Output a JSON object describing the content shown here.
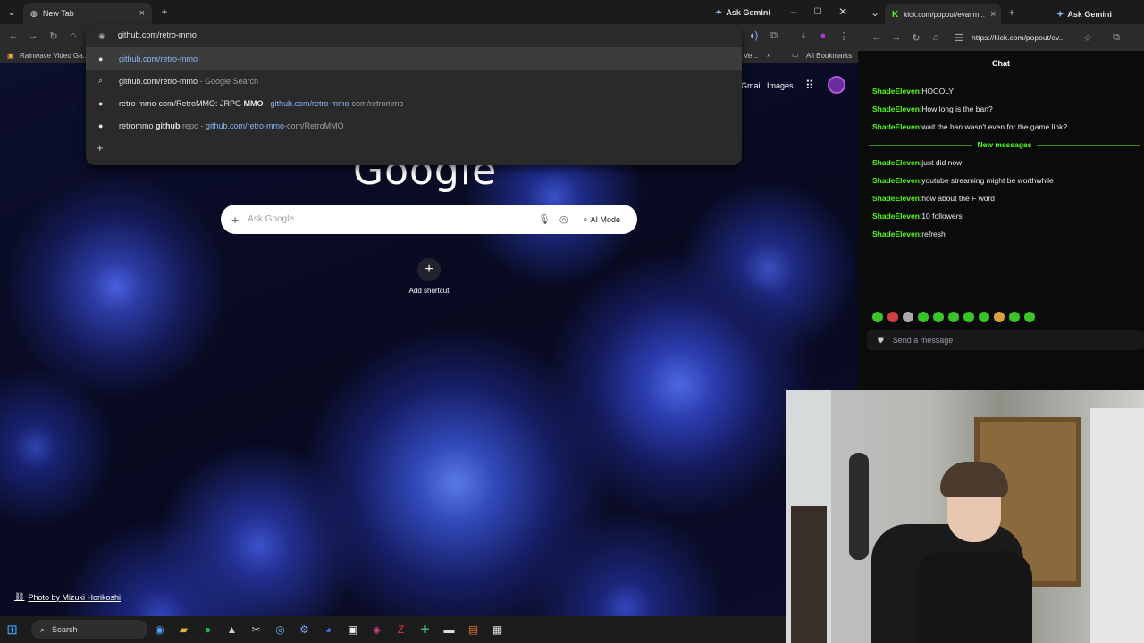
{
  "left_browser": {
    "tab_title": "New Tab",
    "gemini": "Ask Gemini",
    "omnibox": {
      "typed": "github.com/retro-mmo",
      "suggestions": [
        {
          "icon": "github-icon",
          "parts": [
            {
              "t": "github.com/retro-mmo",
              "c": "url"
            }
          ]
        },
        {
          "icon": "search-icon",
          "parts": [
            {
              "t": "github.com/retro-mmo",
              "c": ""
            },
            {
              "t": " - Google Search",
              "c": "dim"
            }
          ]
        },
        {
          "icon": "github-icon",
          "parts": [
            {
              "t": "retro-mmo-com/Retro",
              "c": ""
            },
            {
              "t": "MMO: JRPG ",
              "c": ""
            },
            {
              "t": "MMO",
              "c": "b"
            },
            {
              "t": "  -  ",
              "c": "dim"
            },
            {
              "t": "github.com/retro-mmo",
              "c": "url"
            },
            {
              "t": "-com/retrommo",
              "c": "dim"
            }
          ]
        },
        {
          "icon": "github-icon",
          "parts": [
            {
              "t": "retrommo ",
              "c": ""
            },
            {
              "t": "github",
              "c": "b"
            },
            {
              "t": " repo  -  ",
              "c": "dim"
            },
            {
              "t": "github.com/retro-mmo",
              "c": "url"
            },
            {
              "t": "-com/RetroMMO",
              "c": "dim"
            }
          ]
        }
      ]
    },
    "bookmarks": {
      "first": "Rainwave Video Ga...",
      "partial": "Ve...",
      "all": "All Bookmarks"
    },
    "newtab": {
      "gmail": "Gmail",
      "images": "Images",
      "logo": "Google",
      "search_placeholder": "Ask Google",
      "ai_mode": "AI Mode",
      "add_shortcut": "Add shortcut",
      "photo_credit": "Photo by Mizuki Horikoshi"
    }
  },
  "right_browser": {
    "tab_title": "kick.com/popout/evanm...",
    "gemini": "Ask Gemini",
    "url": "https://kick.com/popout/ev...",
    "chat_title": "Chat",
    "messages_before": [
      {
        "user": "ShadeEleven",
        "text": "HOOOLY"
      },
      {
        "user": "ShadeEleven",
        "text": "How long is the ban?"
      },
      {
        "user": "ShadeEleven",
        "text": "wait the ban wasn't even for the game link?"
      }
    ],
    "new_messages_label": "New messages",
    "messages_after": [
      {
        "user": "ShadeEleven",
        "text": "just did now"
      },
      {
        "user": "ShadeEleven",
        "text": "youtube streaming might be worthwhile"
      },
      {
        "user": "ShadeEleven",
        "text": "how about the F word"
      },
      {
        "user": "ShadeEleven",
        "text": "10 followers"
      },
      {
        "user": "ShadeEleven",
        "text": "refresh"
      }
    ],
    "send_placeholder": "Send a message"
  },
  "taskbar": {
    "search_label": "Search"
  },
  "colors": {
    "kick_green": "#53fc18",
    "link_blue": "#8ab4f8"
  }
}
